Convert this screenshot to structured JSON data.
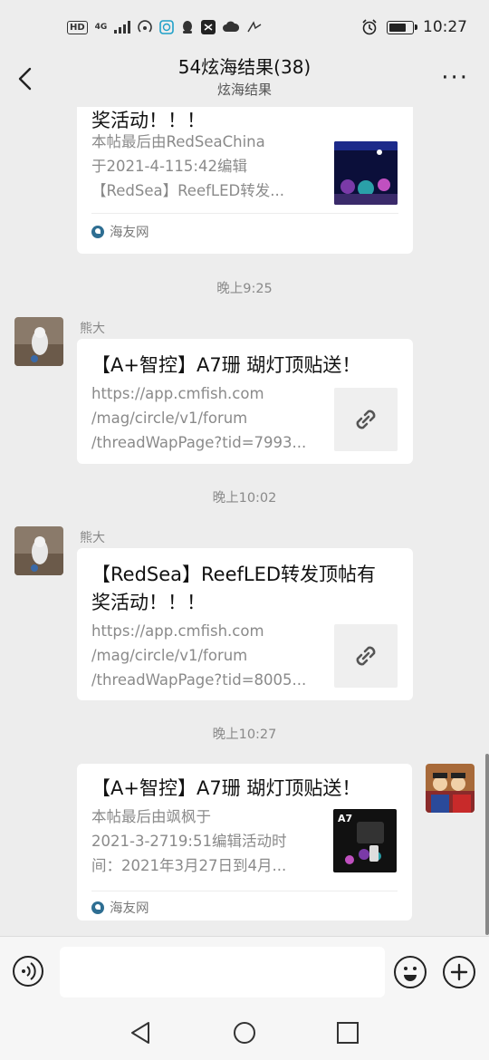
{
  "status_bar": {
    "left_chips": [
      "HD",
      "4G"
    ],
    "time": "10:27"
  },
  "header": {
    "title": "54炫海结果(38)",
    "subtitle": "炫海结果"
  },
  "messages": [
    {
      "type": "article-card",
      "title": "奖活动！！！",
      "desc": [
        "本帖最后由RedSeaChina",
        "于2021-4-115:42编辑",
        "【RedSea】ReefLED转发..."
      ],
      "source": "海友网",
      "thumb_icon": "aquarium-thumbnail"
    },
    {
      "time": "晚上9:25",
      "sender": "熊大",
      "type": "link-card",
      "title": "【A+智控】A7珊 瑚灯顶贴送！",
      "desc": [
        "https://app.cmfish.com",
        "/mag/circle/v1/forum",
        "/threadWapPage?tid=7993..."
      ],
      "thumb_icon": "link-icon"
    },
    {
      "time": "晚上10:02",
      "sender": "熊大",
      "type": "link-card",
      "title": [
        "【RedSea】ReefLED转发顶帖有",
        "奖活动！！！"
      ],
      "desc": [
        "https://app.cmfish.com",
        "/mag/circle/v1/forum",
        "/threadWapPage?tid=8005..."
      ],
      "thumb_icon": "link-icon"
    },
    {
      "time": "晚上10:27",
      "type": "article-card",
      "title": "【A+智控】A7珊 瑚灯顶贴送！",
      "desc": [
        "本帖最后由飒枫于",
        "2021-3-2719:51编辑活动时",
        "间：2021年3月27日到4月..."
      ],
      "source": "海友网",
      "thumb_text": "A7"
    }
  ],
  "colors": {
    "background": "#ededed",
    "card": "#ffffff",
    "muted_text": "#8a8a8a"
  }
}
